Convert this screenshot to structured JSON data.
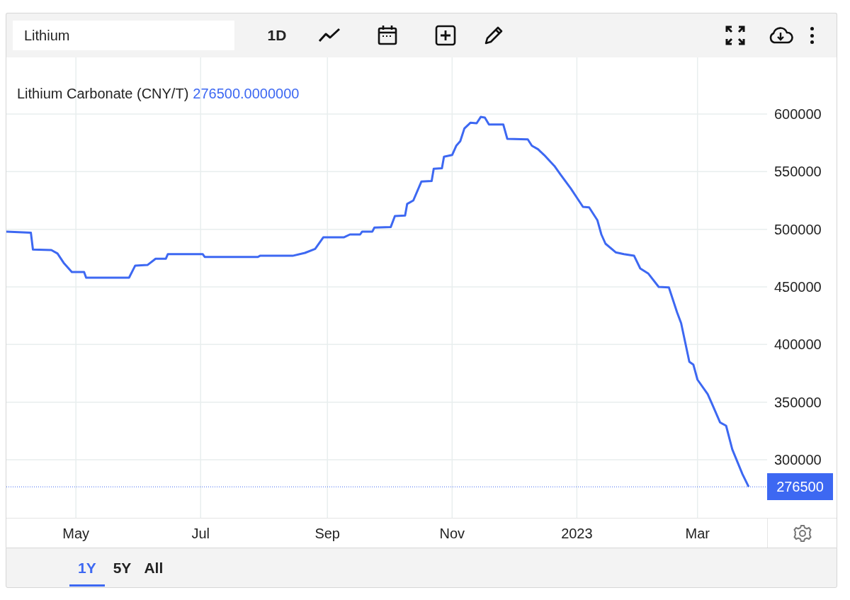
{
  "toolbar": {
    "search": {
      "value": "Lithium"
    },
    "interval": "1D"
  },
  "chart": {
    "legend": {
      "name": "Lithium Carbonate (CNY/T)",
      "value": "276500.0000000"
    },
    "chart_data": {
      "type": "line",
      "grid": true,
      "xlim": [
        "2022-03-28",
        "2023-05-08"
      ],
      "ylim": [
        249600,
        649200
      ],
      "ref_lines": [
        {
          "axis": "y",
          "value": 276500,
          "label": "276500",
          "color": "#3d68f2"
        }
      ],
      "xticks": [
        {
          "value": "2022-05-01",
          "label": "May"
        },
        {
          "value": "2022-07-01",
          "label": "Jul"
        },
        {
          "value": "2022-09-01",
          "label": "Sep"
        },
        {
          "value": "2022-11-01",
          "label": "Nov"
        },
        {
          "value": "2023-01-01",
          "label": "2023"
        },
        {
          "value": "2023-03-01",
          "label": "Mar"
        }
      ],
      "yticks": [
        300000,
        350000,
        400000,
        450000,
        500000,
        550000,
        600000
      ],
      "x": [
        "2022-03-28",
        "2022-04-09",
        "2022-04-10",
        "2022-04-19",
        "2022-04-22",
        "2022-04-25",
        "2022-04-29",
        "2022-05-05",
        "2022-05-06",
        "2022-05-27",
        "2022-05-30",
        "2022-06-05",
        "2022-06-09",
        "2022-06-14",
        "2022-06-15",
        "2022-07-02",
        "2022-07-03",
        "2022-07-29",
        "2022-07-30",
        "2022-08-15",
        "2022-08-21",
        "2022-08-26",
        "2022-08-30",
        "2022-09-09",
        "2022-09-12",
        "2022-09-17",
        "2022-09-18",
        "2022-09-23",
        "2022-09-24",
        "2022-10-02",
        "2022-10-04",
        "2022-10-09",
        "2022-10-10",
        "2022-10-13",
        "2022-10-17",
        "2022-10-22",
        "2022-10-23",
        "2022-10-27",
        "2022-10-28",
        "2022-11-01",
        "2022-11-03",
        "2022-11-05",
        "2022-11-07",
        "2022-11-10",
        "2022-11-13",
        "2022-11-15",
        "2022-11-17",
        "2022-11-19",
        "2022-11-26",
        "2022-11-28",
        "2022-12-08",
        "2022-12-10",
        "2022-12-13",
        "2022-12-16",
        "2022-12-21",
        "2022-12-24",
        "2022-12-29",
        "2023-01-01",
        "2023-01-04",
        "2023-01-07",
        "2023-01-11",
        "2023-01-13",
        "2023-01-15",
        "2023-01-20",
        "2023-01-24",
        "2023-01-29",
        "2023-02-01",
        "2023-02-05",
        "2023-02-10",
        "2023-02-15",
        "2023-02-19",
        "2023-02-21",
        "2023-02-25",
        "2023-02-27",
        "2023-03-01",
        "2023-03-06",
        "2023-03-08",
        "2023-03-12",
        "2023-03-15",
        "2023-03-18",
        "2023-03-23",
        "2023-03-26"
      ],
      "series": [
        {
          "color": "#3d68f2",
          "values": [
            498000,
            497000,
            482500,
            482000,
            479000,
            471000,
            463000,
            463000,
            458000,
            458000,
            468500,
            469000,
            474500,
            474500,
            478500,
            478500,
            476000,
            476000,
            477000,
            477000,
            479500,
            483000,
            493000,
            493000,
            495500,
            495500,
            498000,
            498000,
            501500,
            502000,
            511500,
            512000,
            522000,
            525000,
            541500,
            542000,
            552500,
            553000,
            563000,
            564500,
            572500,
            576500,
            587500,
            592500,
            592000,
            597500,
            597000,
            591000,
            591000,
            578500,
            578000,
            572500,
            569500,
            564500,
            555000,
            547500,
            535500,
            527500,
            519500,
            519000,
            508000,
            495500,
            487500,
            480000,
            478500,
            477000,
            466000,
            461500,
            450000,
            449500,
            428000,
            418500,
            385000,
            382500,
            369500,
            357000,
            349000,
            332500,
            329500,
            309000,
            287500,
            276500
          ]
        }
      ]
    }
  },
  "range_tabs": [
    {
      "label": "1Y",
      "selected": true
    },
    {
      "label": "5Y",
      "selected": false
    },
    {
      "label": "All",
      "selected": false
    }
  ]
}
